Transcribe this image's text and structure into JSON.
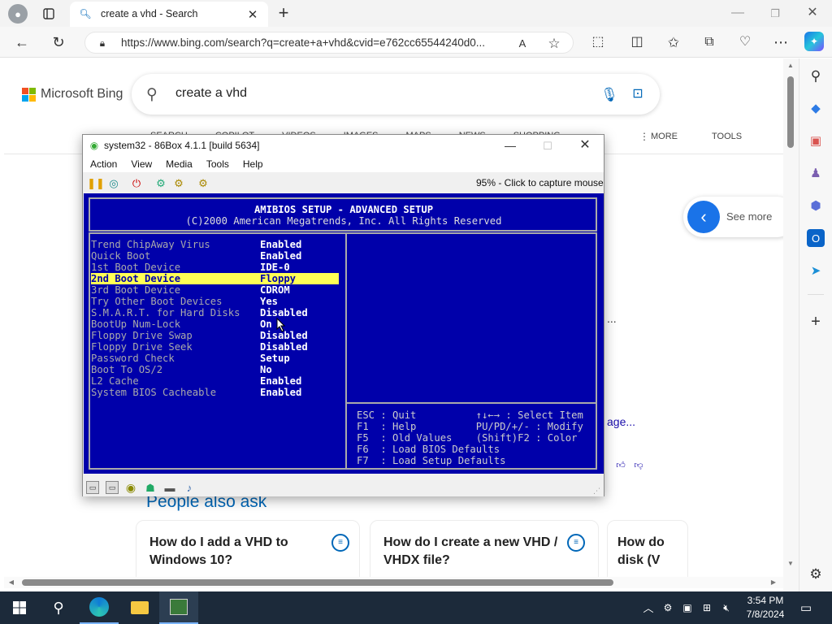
{
  "browser": {
    "tab_title": "create a vhd - Search",
    "url": "https://www.bing.com/search?q=create+a+vhd&cvid=e762cc65544240d0...",
    "new_tab_glyph": "+"
  },
  "bing": {
    "logo_text": "Microsoft Bing",
    "query": "create a vhd",
    "nav": [
      "SEARCH",
      "COPILOT",
      "VIDEOS",
      "IMAGES",
      "MAPS",
      "NEWS",
      "SHOPPING"
    ],
    "more": "MORE",
    "tools": "TOOLS",
    "see_more": "See more",
    "snippet_ellipsis": "...",
    "snippet_link_tail": "age...",
    "people_also_ask": "People also ask",
    "questions": [
      {
        "line1": "How do I add a VHD to",
        "line2": "Windows 10?"
      },
      {
        "line1": "How do I create a new VHD /",
        "line2": "VHDX file?"
      },
      {
        "line1": "How do",
        "line2": "disk (V"
      }
    ]
  },
  "vm": {
    "title": "system32 - 86Box 4.1.1 [build 5634]",
    "menu": [
      "Action",
      "View",
      "Media",
      "Tools",
      "Help"
    ],
    "status": "95% - Click to capture mouse"
  },
  "bios": {
    "heading": "AMIBIOS SETUP - ADVANCED SETUP",
    "copyright": "(C)2000 American Megatrends, Inc. All Rights Reserved",
    "settings": [
      {
        "name": "Trend ChipAway Virus",
        "value": "Enabled"
      },
      {
        "name": "Quick Boot",
        "value": "Enabled"
      },
      {
        "name": "1st Boot Device",
        "value": "IDE-0"
      },
      {
        "name": "2nd Boot Device",
        "value": "Floppy"
      },
      {
        "name": "3rd Boot Device",
        "value": "CDROM"
      },
      {
        "name": "Try Other Boot Devices",
        "value": "Yes"
      },
      {
        "name": "S.M.A.R.T. for Hard Disks",
        "value": "Disabled"
      },
      {
        "name": "BootUp Num-Lock",
        "value": "On"
      },
      {
        "name": "Floppy Drive Swap",
        "value": "Disabled"
      },
      {
        "name": "Floppy Drive Seek",
        "value": "Disabled"
      },
      {
        "name": "Password Check",
        "value": "Setup"
      },
      {
        "name": "Boot To OS/2",
        "value": "No"
      },
      {
        "name": "L2 Cache",
        "value": "Enabled"
      },
      {
        "name": "System BIOS Cacheable",
        "value": "Enabled"
      }
    ],
    "selected_index": 3,
    "help": [
      "ESC : Quit          ↑↓←→ : Select Item",
      "F1  : Help          PU/PD/+/- : Modify",
      "F5  : Old Values    (Shift)F2 : Color",
      "F6  : Load BIOS Defaults",
      "F7  : Load Setup Defaults"
    ]
  },
  "taskbar": {
    "time": "3:54 PM",
    "date": "7/8/2024"
  },
  "colors": {
    "bios_bg": "#0000aa",
    "bios_highlight": "#ffff55",
    "bing_link": "#1a0dab",
    "taskbar": "#1c2a3a",
    "accent": "#0067b8"
  }
}
